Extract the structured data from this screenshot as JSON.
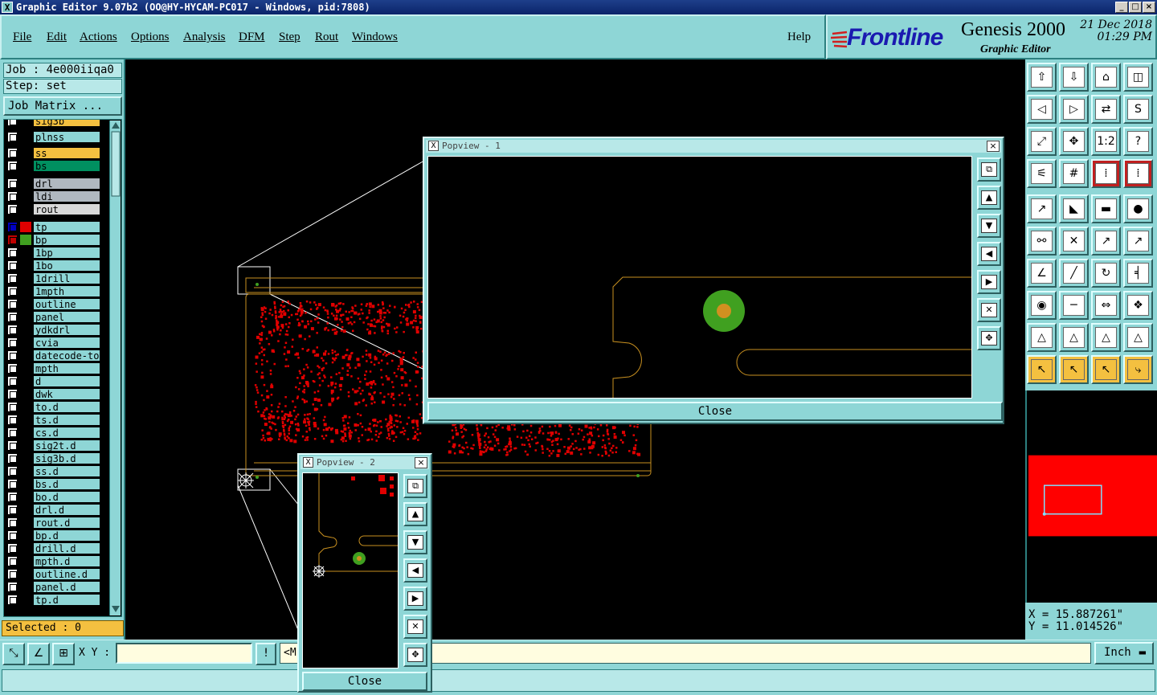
{
  "window": {
    "title": "Graphic Editor 9.07b2  (OO@HY-HYCAM-PC017 - Windows, pid:7808)",
    "min_btn": "_",
    "max_btn": "□",
    "close_btn": "×"
  },
  "menu": {
    "file": "File",
    "edit": "Edit",
    "actions": "Actions",
    "options": "Options",
    "analysis": "Analysis",
    "dfm": "DFM",
    "step": "Step",
    "rout": "Rout",
    "windows": "Windows",
    "help": "Help"
  },
  "logo": {
    "brand": "Frontline",
    "product": "Genesis 2000",
    "subtitle": "Graphic Editor",
    "date": "21 Dec 2018",
    "time": "01:29 PM"
  },
  "job": {
    "job_label": "Job : 4e000iiqa0",
    "step_label": "Step: set",
    "matrix_button": "Job Matrix ..."
  },
  "layers": [
    {
      "name": "sig3b",
      "color": "#f4c040",
      "swatch": ""
    },
    {
      "name": "plnss",
      "color": "#8ed6d6",
      "swatch": ""
    },
    {
      "name": "ss",
      "color": "#f4c040",
      "swatch": ""
    },
    {
      "name": "bs",
      "color": "#009060",
      "swatch": ""
    },
    {
      "name": "drl",
      "color": "#b0b8c0",
      "swatch": ""
    },
    {
      "name": "ldi",
      "color": "#b0b8c0",
      "swatch": ""
    },
    {
      "name": "rout",
      "color": "#d8d8d8",
      "swatch": ""
    },
    {
      "name": "tp",
      "color": "#8ed6d6",
      "swatch": "#e00000"
    },
    {
      "name": "bp",
      "color": "#8ed6d6",
      "swatch": "#40a020"
    },
    {
      "name": "1bp",
      "color": "#8ed6d6",
      "swatch": ""
    },
    {
      "name": "1bo",
      "color": "#8ed6d6",
      "swatch": ""
    },
    {
      "name": "1drill",
      "color": "#8ed6d6",
      "swatch": ""
    },
    {
      "name": "1mpth",
      "color": "#8ed6d6",
      "swatch": ""
    },
    {
      "name": "outline",
      "color": "#8ed6d6",
      "swatch": ""
    },
    {
      "name": "panel",
      "color": "#8ed6d6",
      "swatch": ""
    },
    {
      "name": "ydkdrl",
      "color": "#8ed6d6",
      "swatch": ""
    },
    {
      "name": "cvia",
      "color": "#8ed6d6",
      "swatch": ""
    },
    {
      "name": "datecode-to",
      "color": "#8ed6d6",
      "swatch": ""
    },
    {
      "name": "mpth",
      "color": "#8ed6d6",
      "swatch": ""
    },
    {
      "name": "d",
      "color": "#8ed6d6",
      "swatch": ""
    },
    {
      "name": "dwk",
      "color": "#8ed6d6",
      "swatch": ""
    },
    {
      "name": "to.d",
      "color": "#8ed6d6",
      "swatch": ""
    },
    {
      "name": "ts.d",
      "color": "#8ed6d6",
      "swatch": ""
    },
    {
      "name": "cs.d",
      "color": "#8ed6d6",
      "swatch": ""
    },
    {
      "name": "sig2t.d",
      "color": "#8ed6d6",
      "swatch": ""
    },
    {
      "name": "sig3b.d",
      "color": "#8ed6d6",
      "swatch": ""
    },
    {
      "name": "ss.d",
      "color": "#8ed6d6",
      "swatch": ""
    },
    {
      "name": "bs.d",
      "color": "#8ed6d6",
      "swatch": ""
    },
    {
      "name": "bo.d",
      "color": "#8ed6d6",
      "swatch": ""
    },
    {
      "name": "drl.d",
      "color": "#8ed6d6",
      "swatch": ""
    },
    {
      "name": "rout.d",
      "color": "#8ed6d6",
      "swatch": ""
    },
    {
      "name": "bp.d",
      "color": "#8ed6d6",
      "swatch": ""
    },
    {
      "name": "drill.d",
      "color": "#8ed6d6",
      "swatch": ""
    },
    {
      "name": "mpth.d",
      "color": "#8ed6d6",
      "swatch": ""
    },
    {
      "name": "outline.d",
      "color": "#8ed6d6",
      "swatch": ""
    },
    {
      "name": "panel.d",
      "color": "#8ed6d6",
      "swatch": ""
    },
    {
      "name": "tp.d",
      "color": "#8ed6d6",
      "swatch": ""
    }
  ],
  "selected": "Selected : 0",
  "tools": [
    "arrow-up-page-icon",
    "arrow-down-page-icon",
    "home-icon",
    "split-view-icon",
    "pan-left-icon",
    "pan-right-icon",
    "mirror-icon",
    "s-route-icon",
    "zoom-fit-icon",
    "zoom-center-icon",
    "scale-1-to-1-icon",
    "help-icon",
    "measure-tool-icon",
    "grid-icon",
    "layer-compare-icon",
    "layer-compare-2-icon",
    "add-pad-icon",
    "add-line-icon",
    "ruler-icon",
    "circle-pad-icon",
    "connect-nodes-icon",
    "delete-node-icon",
    "move-node-icon",
    "add-node-icon",
    "angle-icon",
    "draw-line-icon",
    "rotate-icon",
    "snap-icon",
    "pad-select-icon",
    "line-split-icon",
    "dimension-icon",
    "netlist-icon",
    "triangle-icon",
    "triangle-arc-icon",
    "triangle-line-icon",
    "triangle-mark-icon",
    "pointer-icon",
    "select-box-icon",
    "select-arrow-icon",
    "route-icon"
  ],
  "tool_glyphs": {
    "scale": "1:2",
    "help": "?"
  },
  "coords": {
    "x": "X  =  15.887261\"",
    "y": "Y  =  11.014526\""
  },
  "bottom": {
    "xy_label": "X Y :",
    "xy_value": "",
    "info_btn": "!",
    "message": "<M                                    orner",
    "unit": "Inch"
  },
  "popview1": {
    "title": "Popview - 1",
    "close": "Close",
    "close_x": "×"
  },
  "popview2": {
    "title": "Popview - 2",
    "close": "Close",
    "close_x": "×"
  },
  "colors": {
    "panel": "#8ed6d6",
    "canvas": "#000000",
    "copper": "#e00000",
    "outline": "#c89020",
    "pad_green": "#40a020",
    "pad_core": "#d09020",
    "selection": "#f4c040"
  }
}
